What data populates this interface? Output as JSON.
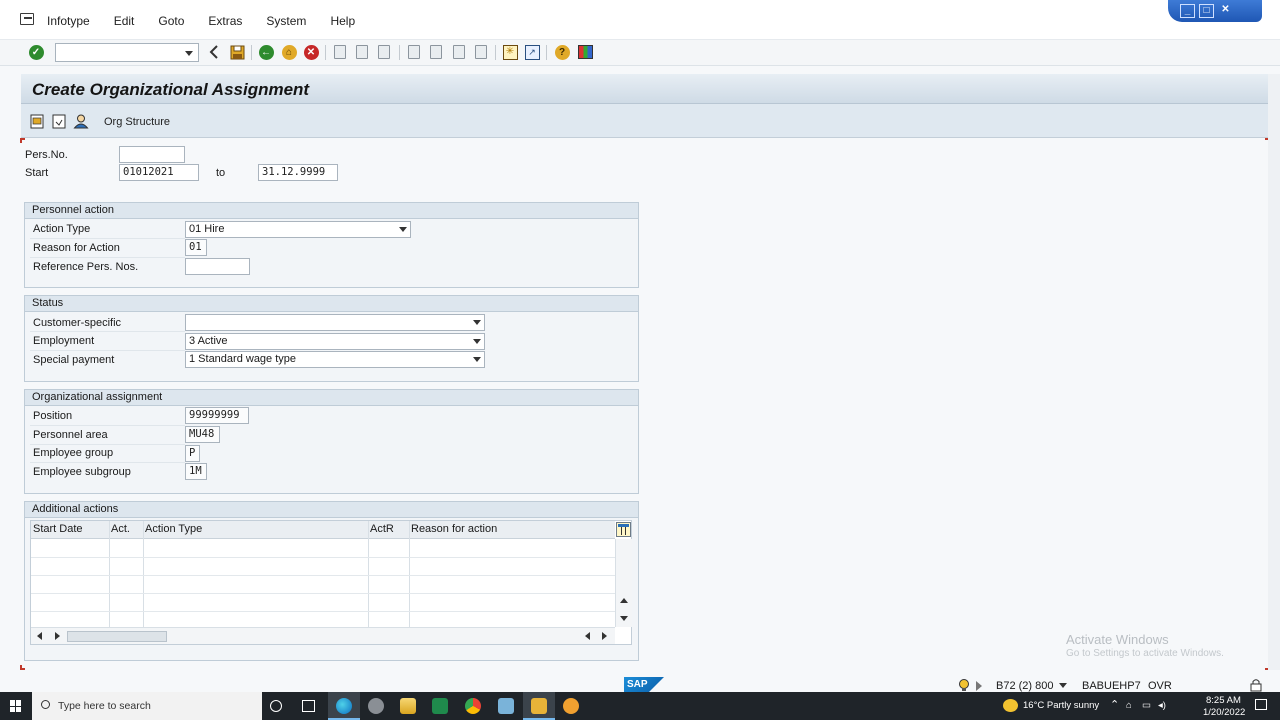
{
  "menu": {
    "items": [
      "Infotype",
      "Edit",
      "Goto",
      "Extras",
      "System",
      "Help"
    ]
  },
  "window_controls": {
    "minimize": "_",
    "maximize": "□",
    "close": "✕"
  },
  "toolbar": {
    "command_field_value": "",
    "icons": [
      "enter-icon",
      "back-icon",
      "save-icon",
      "back-green-icon",
      "exit-icon",
      "cancel-icon",
      "print-icon",
      "find-icon",
      "find-next-icon",
      "first-page-icon",
      "prev-page-icon",
      "next-page-icon",
      "last-page-icon",
      "new-session-icon",
      "shortcut-icon",
      "help-icon",
      "customize-layout-icon"
    ]
  },
  "page": {
    "title": "Create Organizational Assignment",
    "org_structure_label": "Org Structure"
  },
  "header": {
    "pers_no_label": "Pers.No.",
    "pers_no_value": "",
    "start_label": "Start",
    "start_value": "01012021",
    "to_label": "to",
    "end_value": "31.12.9999"
  },
  "personnel_action": {
    "title": "Personnel action",
    "action_type_label": "Action Type",
    "action_type_value": "01 Hire",
    "reason_label": "Reason for Action",
    "reason_value": "01",
    "ref_label": "Reference Pers. Nos.",
    "ref_value": ""
  },
  "status": {
    "title": "Status",
    "customer_label": "Customer-specific",
    "customer_value": "",
    "employment_label": "Employment",
    "employment_value": "3 Active",
    "special_label": "Special payment",
    "special_value": "1 Standard wage type"
  },
  "org_assignment": {
    "title": "Organizational assignment",
    "position_label": "Position",
    "position_value": "99999999",
    "area_label": "Personnel area",
    "area_value": "MU48",
    "group_label": "Employee group",
    "group_value": "P",
    "subgroup_label": "Employee subgroup",
    "subgroup_value": "1M"
  },
  "additional_actions": {
    "title": "Additional actions",
    "columns": [
      "Start Date",
      "Act.",
      "Action Type",
      "ActR",
      "Reason for action"
    ],
    "rows": []
  },
  "statusbar": {
    "system": "B72 (2) 800",
    "server": "BABUEHP7",
    "mode": "OVR"
  },
  "watermark": {
    "line1": "Activate Windows",
    "line2": "Go to Settings to activate Windows."
  },
  "taskbar": {
    "search_placeholder": "Type here to search",
    "weather": "16°C  Partly sunny",
    "time": "8:25 AM",
    "date": "1/20/2022"
  },
  "colors": {
    "accent": "#1f57b4",
    "title_bar": "#dfe8f0",
    "taskbar": "#1f2429"
  }
}
